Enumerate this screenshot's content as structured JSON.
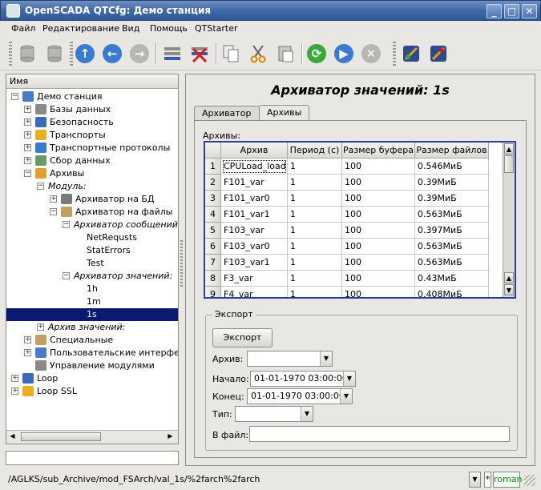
{
  "window": {
    "title": "OpenSCADA QTCfg: Демо станция"
  },
  "menu": [
    "Файл",
    "Редактирование",
    "Вид",
    "Помощь",
    "QTStarter"
  ],
  "toolbar": {
    "icons": [
      "db-load-icon",
      "db-save-icon",
      "up-icon",
      "back-icon",
      "forward-icon",
      "add-item-icon",
      "delete-item-icon",
      "copy-icon",
      "cut-icon",
      "paste-icon",
      "refresh-icon",
      "start-icon",
      "stop-icon",
      "connect-icon",
      "disconnect-icon"
    ]
  },
  "tree": {
    "header": "Имя",
    "nodes": [
      {
        "label": "Демо станция",
        "level": 0,
        "exp": "-"
      },
      {
        "label": "Базы данных",
        "level": 1,
        "exp": "+"
      },
      {
        "label": "Безопасность",
        "level": 1,
        "exp": "+"
      },
      {
        "label": "Транспорты",
        "level": 1,
        "exp": "+"
      },
      {
        "label": "Транспортные протоколы",
        "level": 1,
        "exp": "+"
      },
      {
        "label": "Сбор данных",
        "level": 1,
        "exp": "+"
      },
      {
        "label": "Архивы",
        "level": 1,
        "exp": "-"
      },
      {
        "label": "Модуль:",
        "level": 2,
        "exp": "-",
        "italic": true
      },
      {
        "label": "Архиватор на БД",
        "level": 3,
        "exp": "+"
      },
      {
        "label": "Архиватор на файлы",
        "level": 3,
        "exp": "-"
      },
      {
        "label": "Архиватор сообщений",
        "level": 4,
        "exp": "-",
        "italic": true
      },
      {
        "label": "NetRequsts",
        "level": 5,
        "exp": ""
      },
      {
        "label": "StatErrors",
        "level": 5,
        "exp": ""
      },
      {
        "label": "Test",
        "level": 5,
        "exp": ""
      },
      {
        "label": "Архиватор значений:",
        "level": 4,
        "exp": "-",
        "italic": true
      },
      {
        "label": "1h",
        "level": 5,
        "exp": ""
      },
      {
        "label": "1m",
        "level": 5,
        "exp": ""
      },
      {
        "label": "1s",
        "level": 5,
        "exp": "",
        "selected": true
      },
      {
        "label": "Архив значений:",
        "level": 2,
        "exp": "+",
        "italic": true
      },
      {
        "label": "Специальные",
        "level": 1,
        "exp": "+"
      },
      {
        "label": "Пользовательские интерфейсы",
        "level": 1,
        "exp": "+"
      },
      {
        "label": "Управление модулями",
        "level": 1,
        "exp": ""
      },
      {
        "label": "Loop",
        "level": 0,
        "exp": "+"
      },
      {
        "label": "Loop SSL",
        "level": 0,
        "exp": "+"
      }
    ]
  },
  "page": {
    "title": "Архиватор значений: 1s",
    "tabs": [
      "Архиватор",
      "Архивы"
    ],
    "archives_label": "Архивы:",
    "table": {
      "columns": [
        "Архив",
        "Период (с)",
        "Размер буфера",
        "Размер файлов"
      ],
      "rows": [
        [
          "1",
          "CPULoad_load",
          "1",
          "100",
          "0.546МиБ"
        ],
        [
          "2",
          "F101_var",
          "1",
          "100",
          "0.39МиБ"
        ],
        [
          "3",
          "F101_var0",
          "1",
          "100",
          "0.39МиБ"
        ],
        [
          "4",
          "F101_var1",
          "1",
          "100",
          "0.563МиБ"
        ],
        [
          "5",
          "F103_var",
          "1",
          "100",
          "0.397МиБ"
        ],
        [
          "6",
          "F103_var0",
          "1",
          "100",
          "0.563МиБ"
        ],
        [
          "7",
          "F103_var1",
          "1",
          "100",
          "0.563МиБ"
        ],
        [
          "8",
          "F3_var",
          "1",
          "100",
          "0.43МиБ"
        ],
        [
          "9",
          "F4_var",
          "1",
          "100",
          "0.408МиБ"
        ]
      ]
    },
    "export": {
      "legend": "Экспорт",
      "button": "Экспорт",
      "archive_label": "Архив:",
      "archive_value": "",
      "start_label": "Начало:",
      "start_value": "01-01-1970 03:00:00",
      "end_label": "Конец:",
      "end_value": "01-01-1970 03:00:00",
      "type_label": "Тип:",
      "type_value": "",
      "file_label": "В файл:",
      "file_value": ""
    }
  },
  "status": {
    "path": "/AGLKS/sub_Archive/mod_FSArch/val_1s/%2farch%2farch",
    "star": "*",
    "user": "roman"
  }
}
